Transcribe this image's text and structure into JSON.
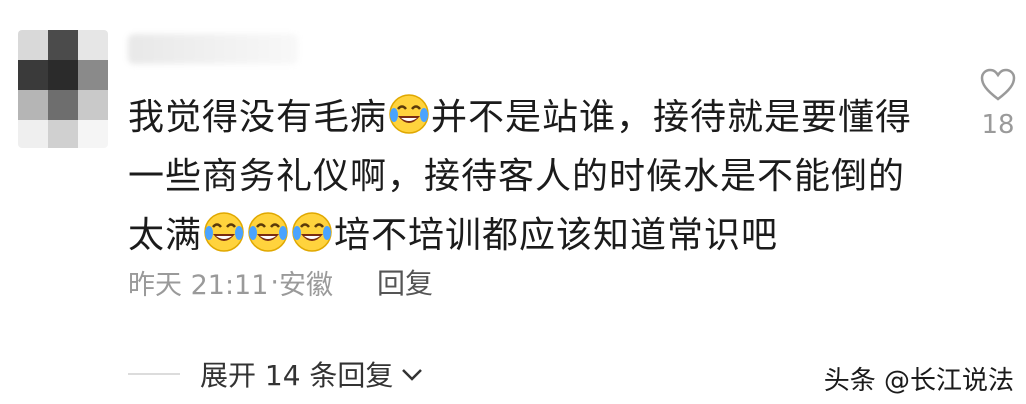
{
  "comment": {
    "part1": "我觉得没有毛病",
    "part2": "并不是站谁，接待就是要懂得一些商务礼仪啊，接待客人的时候水是不能倒的太满",
    "part3": "培不培训都应该知道常识吧",
    "emoji_name": "laughing-crying-emoji"
  },
  "meta": {
    "time": "昨天 21:11",
    "location": "安徽",
    "reply_label": "回复"
  },
  "like": {
    "count": "18"
  },
  "expand": {
    "label": "展开 14 条回复"
  },
  "watermark": {
    "text": "头条 @长江说法"
  },
  "colors": {
    "text": "#1b1b1b",
    "meta": "#9a9a9a",
    "icon": "#9a9a9a"
  }
}
